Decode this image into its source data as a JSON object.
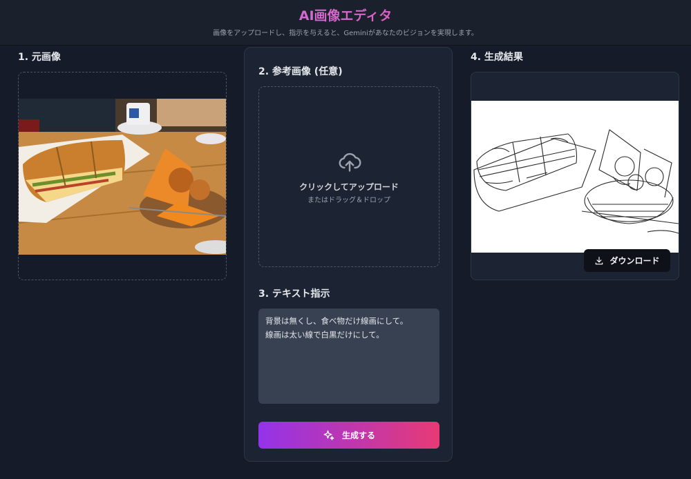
{
  "header": {
    "title": "AI画像エディタ",
    "subtitle": "画像をアップロードし、指示を与えると、Geminiがあなたのビジョンを実現します。"
  },
  "sections": {
    "original": "1. 元画像",
    "reference": "2. 参考画像 (任意)",
    "instruction": "3. テキスト指示",
    "result": "4. 生成結果"
  },
  "upload": {
    "main_label": "クリックしてアップロード",
    "sub_label": "またはドラッグ＆ドロップ",
    "icon": "cloud-upload-icon"
  },
  "prompt": {
    "value": "背景は無くし、食べ物だけ線画にして。\n線画は太い線で白黒だけにして。"
  },
  "generate_button": {
    "label": "生成する",
    "icon": "sparkles-icon"
  },
  "download_button": {
    "label": "ダウンロード",
    "icon": "download-icon"
  },
  "colors": {
    "background": "#151b29",
    "panel": "#1c2433",
    "accent_start": "#9333ea",
    "accent_end": "#e73a75",
    "title_gradient_start": "#c084fc",
    "title_gradient_end": "#ec4899"
  }
}
